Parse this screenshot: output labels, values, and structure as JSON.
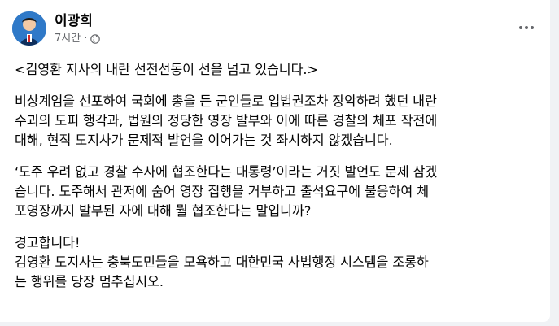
{
  "post": {
    "author": "이광희",
    "time": "7시간",
    "separator": "·",
    "paragraphs": [
      [
        "<김영환 지사의 내란 선전선동이 선을 넘고 있습니다.>"
      ],
      [
        "비상계엄을 선포하여 국회에 총을 든 군인들로 입법권조차 장악하려 했던 내란",
        "수괴의 도피 행각과, 법원의 정당한 영장 발부와 이에 따른 경찰의 체포 작전에",
        "대해, 현직 도지사가 문제적 발언을 이어가는 것 좌시하지 않겠습니다."
      ],
      [
        "‘도주 우려 없고 경찰 수사에 협조한다는 대통령’이라는 거짓 발언도 문제 삼겠",
        "습니다. 도주해서 관저에 숨어 영장 집행을 거부하고 출석요구에 불응하여 체",
        "포영장까지 발부된 자에 대해 뭘 협조한다는 말입니까?"
      ],
      [
        "경고합니다!",
        "김영환 도지사는 충북도민들을 모욕하고 대한민국 사법행정 시스템을 조롱하",
        "는 행위를 당장 멈추십시오."
      ]
    ]
  },
  "icons": {
    "privacy": "globe-icon",
    "menu": "more-options-icon",
    "profile": "avatar"
  },
  "colors": {
    "name": "#050505",
    "meta": "#65676b",
    "body": "#050505",
    "background": "#f0f2f5",
    "card": "#ffffff"
  }
}
